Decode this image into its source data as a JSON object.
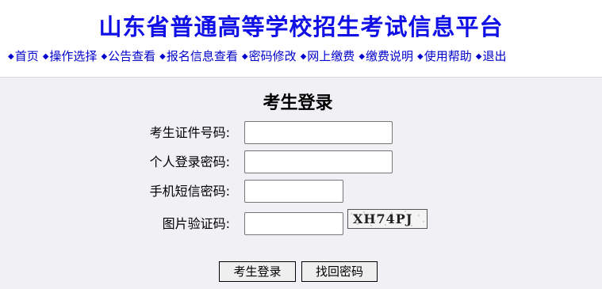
{
  "header": {
    "title": "山东省普通高等学校招生考试信息平台",
    "title_color": "#1010e6",
    "nav": [
      {
        "label": "首页"
      },
      {
        "label": "操作选择"
      },
      {
        "label": "公告查看"
      },
      {
        "label": "报名信息查看"
      },
      {
        "label": "密码修改"
      },
      {
        "label": "网上缴费"
      },
      {
        "label": "缴费说明"
      },
      {
        "label": "使用帮助"
      },
      {
        "label": "退出"
      }
    ],
    "nav_bullet_icon": "diamond-icon"
  },
  "login": {
    "title": "考生登录",
    "fields": {
      "id_number": {
        "label": "考生证件号码:",
        "value": ""
      },
      "password": {
        "label": "个人登录密码:",
        "value": ""
      },
      "sms_code": {
        "label": "手机短信密码:",
        "value": ""
      },
      "captcha": {
        "label": "图片验证码:",
        "value": "",
        "image_text": "XH74PJ"
      }
    },
    "buttons": {
      "submit": "考生登录",
      "recover": "找回密码"
    }
  },
  "colors": {
    "background": "#f0f0f5",
    "header_background": "#ffffff",
    "link": "#0000cc"
  }
}
